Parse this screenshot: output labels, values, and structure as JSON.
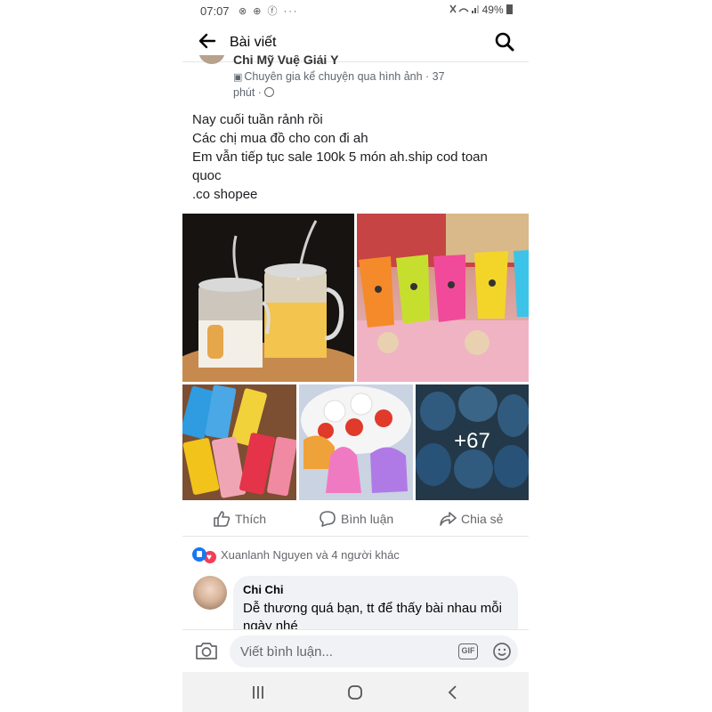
{
  "status_bar": {
    "time": "07:07",
    "notification_icons": "⊗ ⊕ ⓕ ···",
    "right_text": "49%",
    "icons": [
      "mute-icon",
      "wifi-icon",
      "signal-icon",
      "battery-icon"
    ]
  },
  "app_bar": {
    "title": "Bài viết",
    "back_icon": "arrow-left-icon",
    "search_icon": "search-icon"
  },
  "post": {
    "author": "Chi Mỹ Vuệ Giải Ý",
    "meta_line1": "Chuyên gia kể chuyện qua hình ảnh · 37",
    "meta_line2": "phút ·",
    "text_lines": [
      "Nay cuối tuần rảnh rồi",
      "Các chị mua đồ cho con đi ah",
      "Em vẫn tiếp tục sale 100k 5 món ah.ship cod toan",
      "quoc",
      ".co shopee"
    ],
    "more_photos": "+67"
  },
  "actions": {
    "like": "Thích",
    "comment": "Bình luận",
    "share": "Chia sẻ"
  },
  "reactions": {
    "text": "Xuanlanh Nguyen và 4 người khác"
  },
  "comment": {
    "name": "Chi Chi",
    "text": "Dễ thương quá bạn, tt để thấy bài nhau mỗi ngày nhé"
  },
  "composer": {
    "placeholder": "Viết bình luận...",
    "gif_label": "GIF"
  },
  "colors": {
    "accent": "#1877f2",
    "heart": "#f33e58",
    "muted": "#65676b"
  }
}
